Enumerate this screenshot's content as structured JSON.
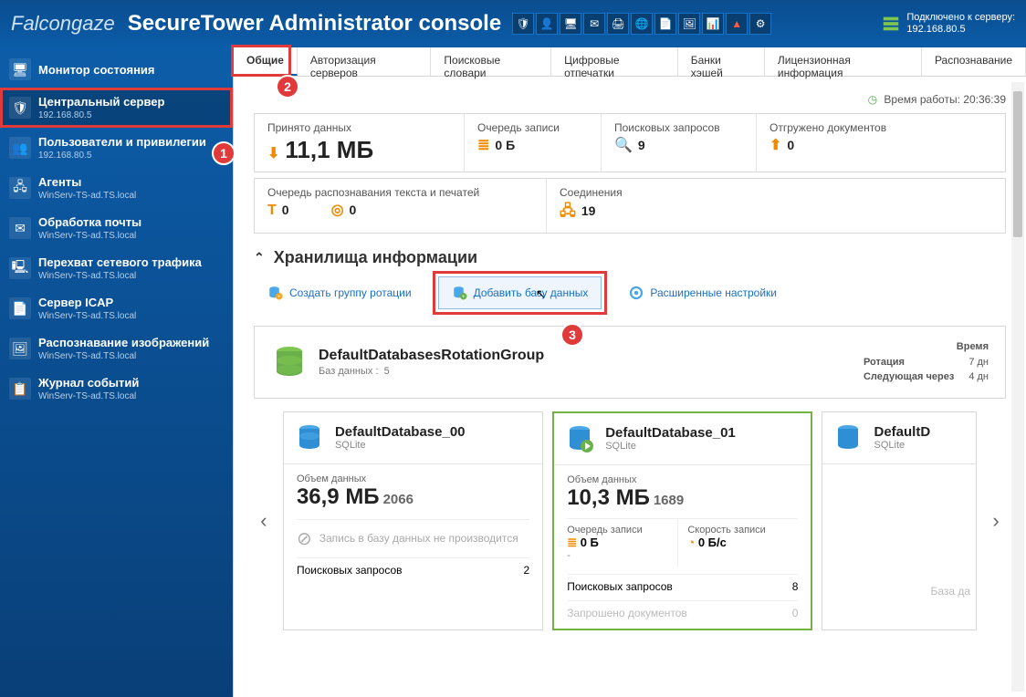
{
  "header": {
    "brand": "Falcongaze",
    "product": "SecureTower Administrator console",
    "connected_label": "Подключено к серверу:",
    "connected_ip": "192.168.80.5"
  },
  "sidebar": [
    {
      "label": "Монитор состояния",
      "sub": ""
    },
    {
      "label": "Центральный сервер",
      "sub": "192.168.80.5",
      "active": true
    },
    {
      "label": "Пользователи и привилегии",
      "sub": "192.168.80.5"
    },
    {
      "label": "Агенты",
      "sub": "WinServ-TS-ad.TS.local"
    },
    {
      "label": "Обработка почты",
      "sub": "WinServ-TS-ad.TS.local"
    },
    {
      "label": "Перехват сетевого трафика",
      "sub": "WinServ-TS-ad.TS.local"
    },
    {
      "label": "Сервер ICAP",
      "sub": "WinServ-TS-ad.TS.local"
    },
    {
      "label": "Распознавание изображений",
      "sub": "WinServ-TS-ad.TS.local"
    },
    {
      "label": "Журнал событий",
      "sub": "WinServ-TS-ad.TS.local"
    }
  ],
  "tabs": [
    "Общие",
    "Авторизация серверов",
    "Поисковые словари",
    "Цифровые отпечатки",
    "Банки хэшей",
    "Лицензионная информация",
    "Распознавание"
  ],
  "uptime": {
    "label": "Время работы:",
    "value": "20:36:39"
  },
  "stats_top": {
    "received_label": "Принято данных",
    "received_value": "11,1 МБ",
    "queue_label": "Очередь записи",
    "queue_value": "0 Б",
    "search_label": "Поисковых запросов",
    "search_value": "9",
    "docs_label": "Отгружено документов",
    "docs_value": "0"
  },
  "stats_bottom": {
    "recog_label": "Очередь распознавания текста и печатей",
    "recog_v1": "0",
    "recog_v2": "0",
    "conn_label": "Соединения",
    "conn_value": "19"
  },
  "section": {
    "title": "Хранилища информации"
  },
  "toolbar": {
    "create": "Создать группу ротации",
    "add": "Добавить базу данных",
    "adv": "Расширенные настройки"
  },
  "group": {
    "name": "DefaultDatabasesRotationGroup",
    "sub_label": "Баз данных :",
    "sub_count": "5",
    "col_time": "Время",
    "row_rot": "Ротация",
    "row_rot_v": "7 дн",
    "row_next": "Следующая через",
    "row_next_v": "4 дн"
  },
  "db_cards": [
    {
      "name": "DefaultDatabase_00",
      "type": "SQLite",
      "size_label": "Объем данных",
      "size": "36,9 МБ",
      "count": "2066",
      "idle": "Запись в базу данных не производится",
      "q_label": "Поисковых запросов",
      "q_val": "2"
    },
    {
      "name": "DefaultDatabase_01",
      "type": "SQLite",
      "size_label": "Объем данных",
      "size": "10,3 МБ",
      "count": "1689",
      "queue_label": "Очередь записи",
      "queue_val": "0 Б",
      "queue_dash": "-",
      "speed_label": "Скорость записи",
      "speed_val": "0 Б/с",
      "q_label": "Поисковых запросов",
      "q_val": "8",
      "req_label": "Запрошено документов",
      "req_val": "0"
    },
    {
      "name": "DefaultD",
      "type": "SQLite",
      "extra": "База да"
    }
  ],
  "callouts": {
    "c1": "1",
    "c2": "2",
    "c3": "3"
  }
}
